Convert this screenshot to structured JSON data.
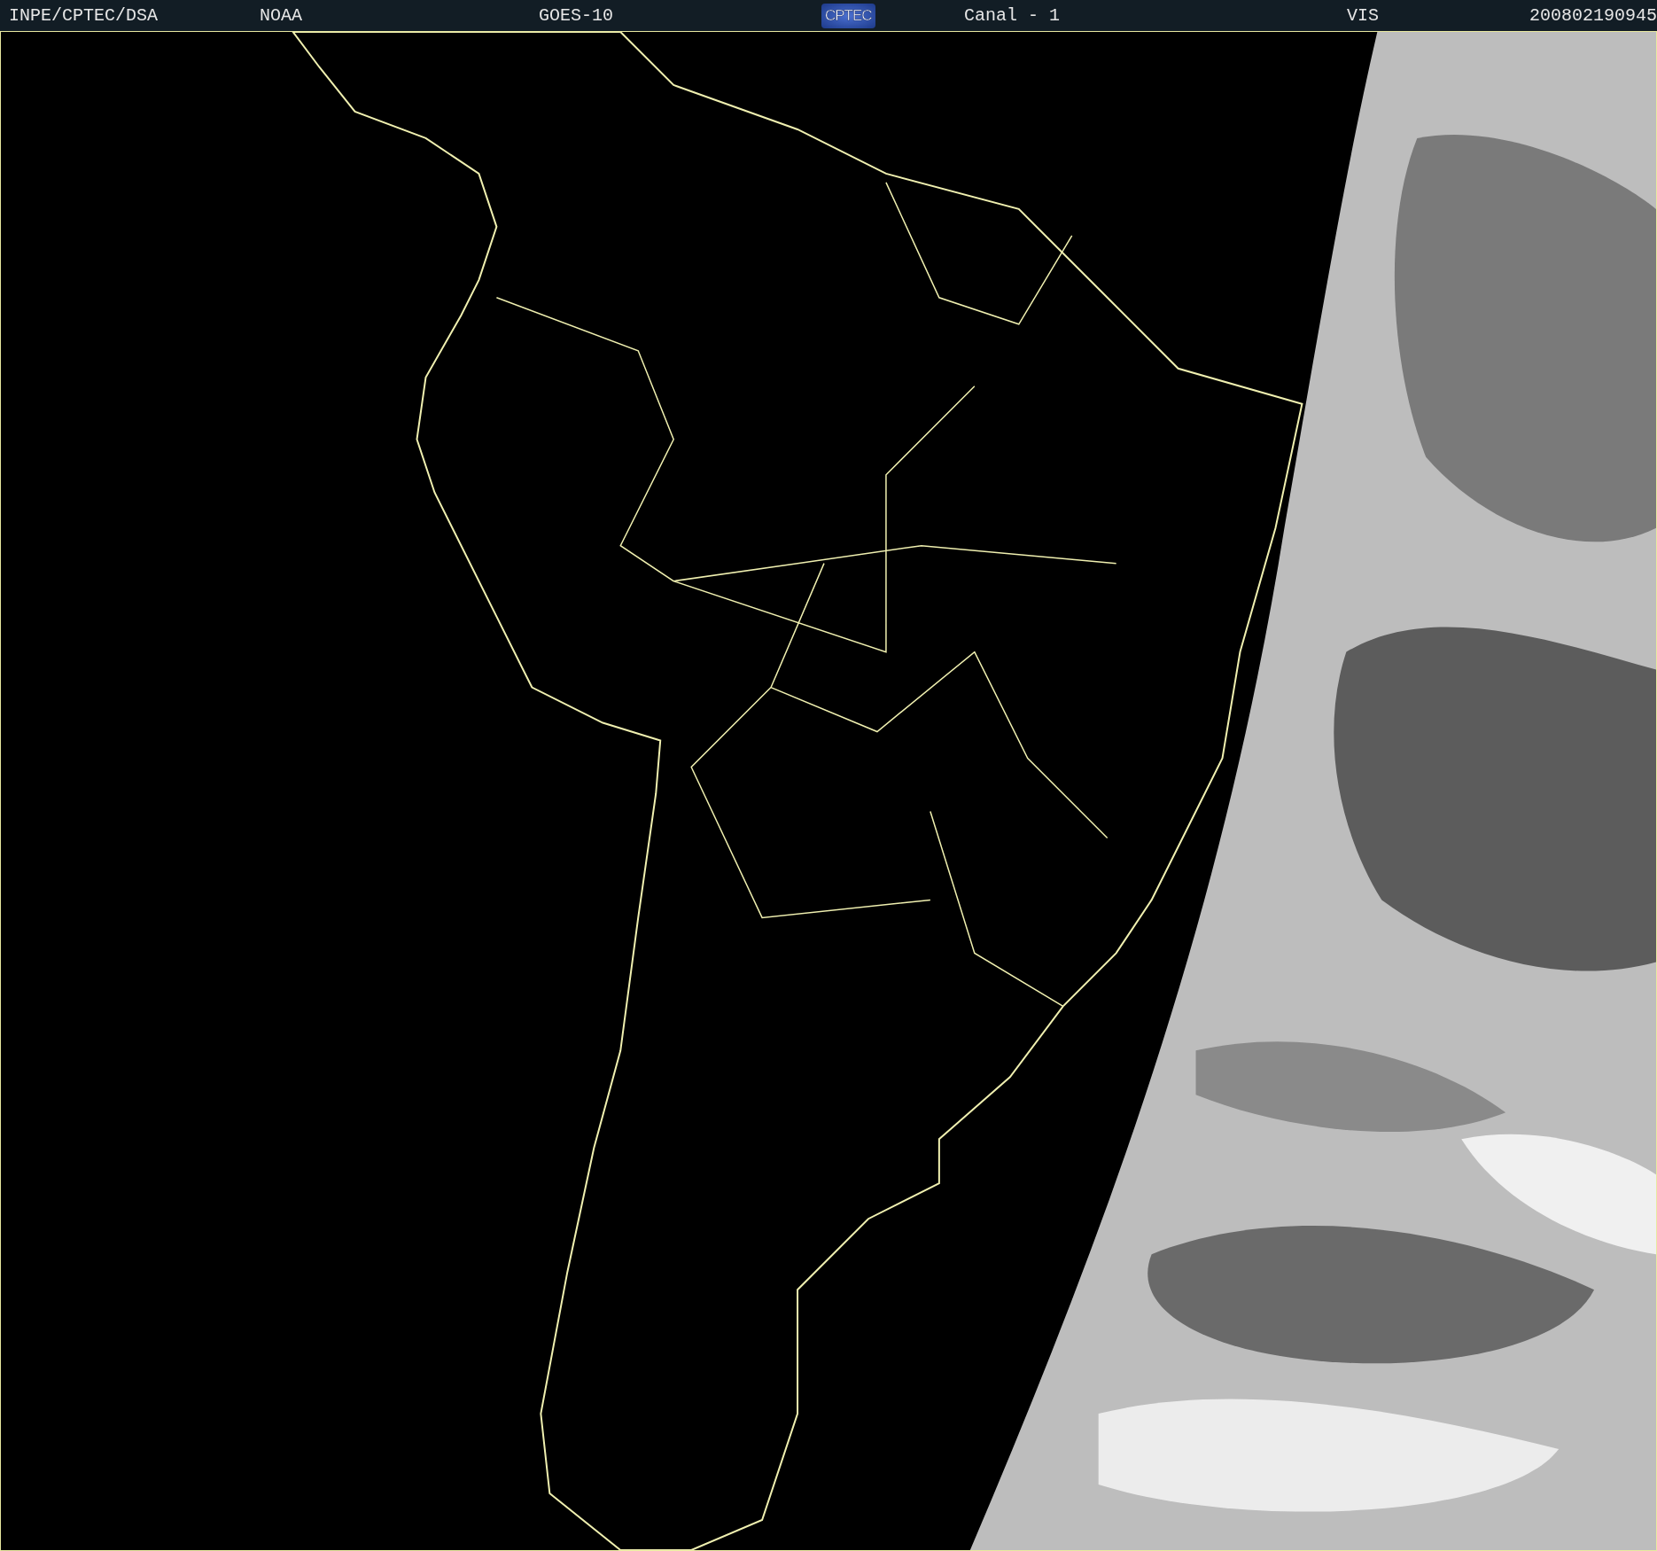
{
  "header": {
    "items": [
      {
        "kind": "text",
        "text": "INPE/CPTEC/DSA"
      },
      {
        "kind": "text",
        "text": "NOAA"
      },
      {
        "kind": "text",
        "text": "GOES-10"
      },
      {
        "kind": "logo",
        "text": "CPTEC"
      },
      {
        "kind": "text",
        "text": "Canal - 1"
      },
      {
        "kind": "text",
        "text": "VIS"
      },
      {
        "kind": "text",
        "text": "200802190945"
      }
    ]
  }
}
